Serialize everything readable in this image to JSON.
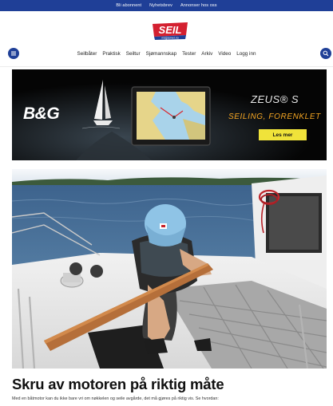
{
  "top_links": [
    "Bli abonnent",
    "Nyhetsbrev",
    "Annonser hos oss"
  ],
  "brand": {
    "logo_text": "SEIL",
    "logo_sub": "magasinet.no",
    "accent": "#1f3f97",
    "logo_red": "#d42030"
  },
  "nav_items": [
    "Seilbåter",
    "Praktisk",
    "Seiltur",
    "Sjømannskap",
    "Tester",
    "Arkiv",
    "Video",
    "Logg inn"
  ],
  "icons": {
    "menu": "menu-icon",
    "search": "search-icon"
  },
  "ad": {
    "brand": "B&G",
    "product": "ZEUS® S",
    "tagline": "SEILING, FORENKLET",
    "cta": "Les mer",
    "cta_color": "#f0e33a",
    "tagline_color": "#f4a522"
  },
  "article": {
    "title": "Skru av motoren på riktig måte",
    "lede": "Med en båtmotor kan du ikke bare vri om nøkkelen og seile avgårde, det må gjøres på riktig vis. Se hvordan:"
  }
}
